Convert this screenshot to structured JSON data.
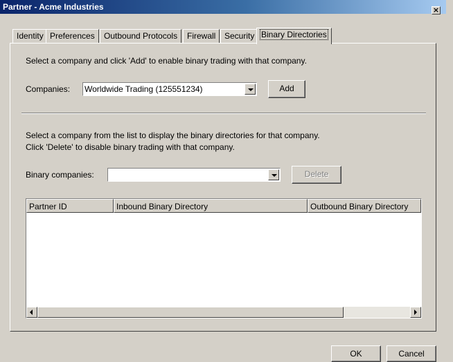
{
  "window": {
    "title": "Partner - Acme Industries",
    "close_glyph": "×"
  },
  "tabs": [
    {
      "label": "Identity"
    },
    {
      "label": "Preferences"
    },
    {
      "label": "Outbound Protocols"
    },
    {
      "label": "Firewall"
    },
    {
      "label": "Security"
    },
    {
      "label": "Binary Directories",
      "active": true
    }
  ],
  "companies_section": {
    "instruction": "Select a company and click 'Add' to enable binary trading with that company.",
    "companies_label": "Companies:",
    "selected_company": "Worldwide Trading (125551234)",
    "add_label": "Add"
  },
  "binary_section": {
    "instruction_line1": "Select a company from the list to display the binary directories for that company.",
    "instruction_line2": "Click 'Delete' to disable binary trading with that company.",
    "binary_companies_label": "Binary companies:",
    "binary_companies_value": "",
    "delete_label": "Delete",
    "delete_enabled": false
  },
  "table": {
    "columns": [
      "Partner ID",
      "Inbound Binary Directory",
      "Outbound Binary Directory"
    ],
    "rows": []
  },
  "footer": {
    "ok_label": "OK",
    "cancel_label": "Cancel"
  },
  "colors": {
    "titlebar_start": "#0a246a",
    "titlebar_end": "#a6caf0",
    "face": "#d4d0c8"
  }
}
